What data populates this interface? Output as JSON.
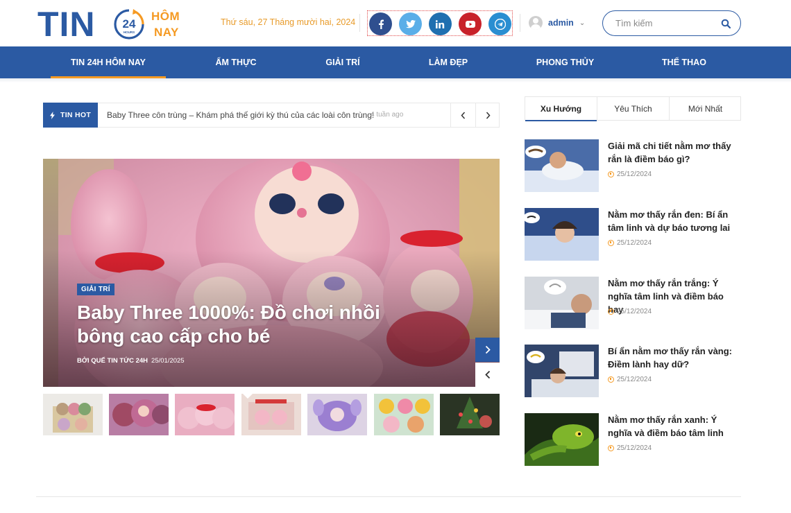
{
  "brand": {
    "logo_main": "TIN",
    "logo_badge": "24",
    "logo_badge_small": "HOURS",
    "logo_line1": "HÔM",
    "logo_line2": "NAY",
    "primary_color": "#2b5aa3",
    "accent_color": "#f59a23"
  },
  "header": {
    "date": "Thứ sáu, 27 Tháng mười hai, 2024",
    "socials": [
      {
        "icon": "facebook-icon",
        "color": "#2f4f8f"
      },
      {
        "icon": "twitter-icon",
        "color": "#5aaee8"
      },
      {
        "icon": "linkedin-icon",
        "color": "#1f6fb0"
      },
      {
        "icon": "youtube-icon",
        "color": "#c8222a"
      },
      {
        "icon": "telegram-icon",
        "color": "#2a8ed1"
      }
    ],
    "user": "admin",
    "search_placeholder": "Tìm kiếm"
  },
  "nav": {
    "items": [
      {
        "label": "TIN 24H HÔM NAY",
        "active": true
      },
      {
        "label": "ẨM THỰC"
      },
      {
        "label": "GIẢI TRÍ"
      },
      {
        "label": "LÀM ĐẸP"
      },
      {
        "label": "PHONG THỦY"
      },
      {
        "label": "THỂ THAO"
      }
    ]
  },
  "ticker": {
    "label": "TIN HOT",
    "text": "Baby Three côn trùng – Khám phá thế giới kỳ thú của các loài côn trùng!",
    "time": "4 tuần ago"
  },
  "hero": {
    "category": "GIẢI TRÍ",
    "title": "Baby Three 1000%: Đồ chơi nhồi bông cao cấp cho bé",
    "author": "BỞI QUẾ TIN TỨC 24H",
    "date": "25/01/2025"
  },
  "sidebar": {
    "tabs": [
      {
        "label": "Xu Hướng",
        "active": true
      },
      {
        "label": "Yêu Thích"
      },
      {
        "label": "Mới Nhất"
      }
    ],
    "posts": [
      {
        "title": "Giải mã chi tiết nằm mơ thấy rắn là điềm báo gì?",
        "date": "25/12/2024"
      },
      {
        "title": "Nằm mơ thấy rắn đen: Bí ẩn tâm linh và dự báo tương lai",
        "date": "25/12/2024"
      },
      {
        "title": "Nằm mơ thấy rắn trắng: Ý nghĩa tâm linh và điềm báo hay",
        "date": "25/12/2024"
      },
      {
        "title": "Bí ẩn nằm mơ thấy rắn vàng: Điềm lành hay dữ?",
        "date": "25/12/2024"
      },
      {
        "title": "Nằm mơ thấy rắn xanh: Ý nghĩa và điềm báo tâm linh",
        "date": "25/12/2024"
      }
    ]
  }
}
